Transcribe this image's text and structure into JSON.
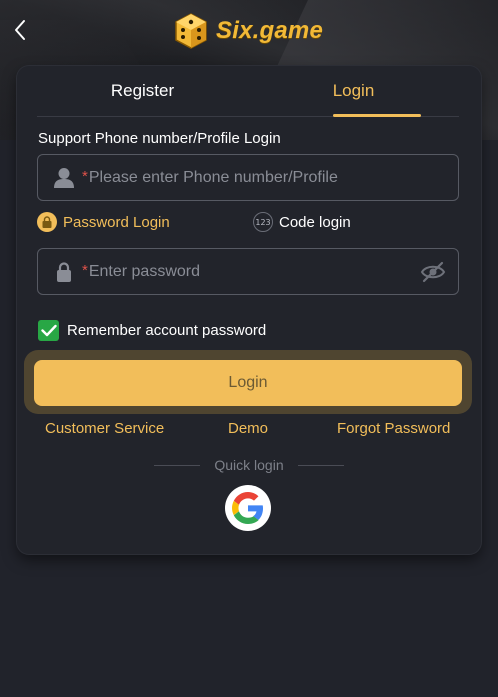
{
  "brand": {
    "name": "Six.game",
    "logo_icon": "dice-logo-icon"
  },
  "tabs": [
    {
      "label": "Register",
      "active": false
    },
    {
      "label": "Login",
      "active": true
    }
  ],
  "form": {
    "section_label": "Support Phone number/Profile Login",
    "phone": {
      "required_mark": "*",
      "placeholder": "Please enter Phone number/Profile",
      "icon": "user-icon"
    },
    "modes": {
      "password_label": "Password Login",
      "code_label": "Code login",
      "code_badge": "123"
    },
    "password": {
      "required_mark": "*",
      "placeholder": "Enter password",
      "icon": "lock-icon",
      "toggle_icon": "eye-off-icon"
    },
    "remember": {
      "label": "Remember account password",
      "checked": true
    },
    "submit_label": "Login"
  },
  "links": {
    "customer_service": "Customer Service",
    "demo": "Demo",
    "forgot_password": "Forgot Password"
  },
  "quick_login": {
    "label": "Quick login",
    "providers": [
      "google"
    ]
  },
  "colors": {
    "accent": "#f2be5a",
    "background": "#21232b",
    "card": "#22242b",
    "check": "#28a745",
    "required": "#e0524a"
  }
}
